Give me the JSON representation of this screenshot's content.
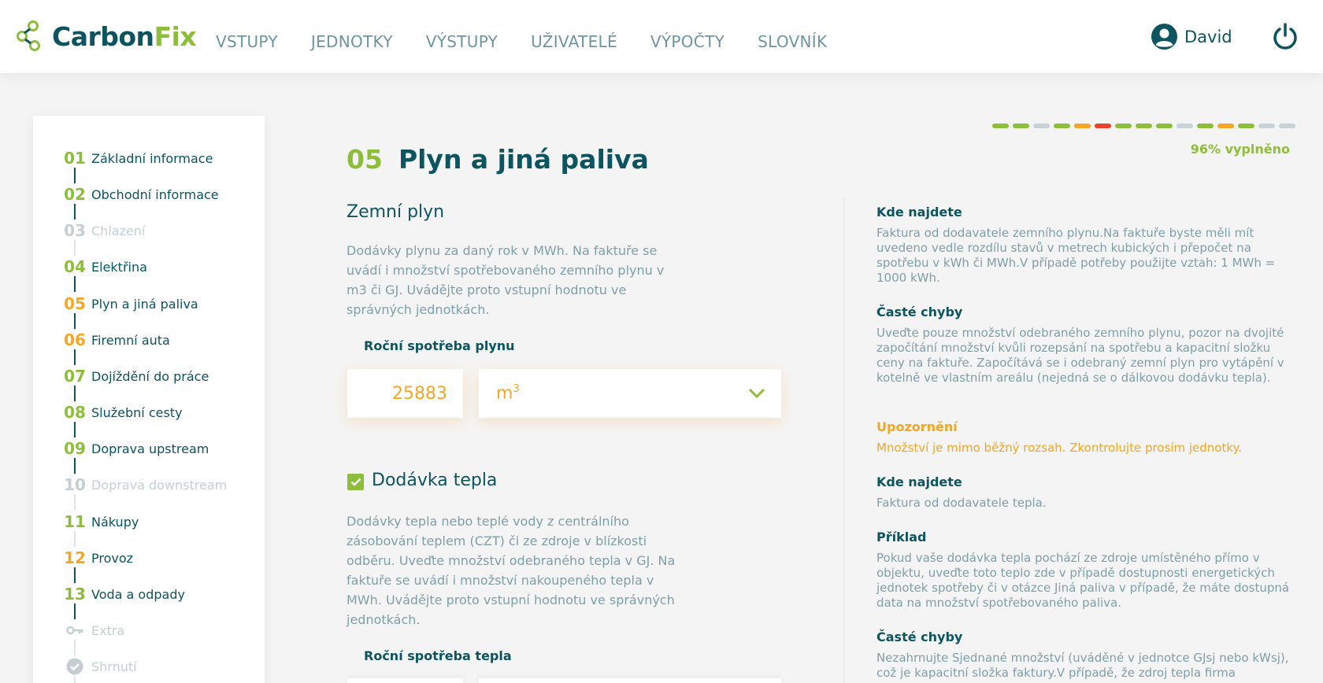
{
  "app": {
    "logo_part1": "Carbon",
    "logo_part2": "Fix",
    "brand_color": "#0c5460",
    "accent_color": "#8dbe3a",
    "warning_color": "#f5a623"
  },
  "nav": [
    "VSTUPY",
    "JEDNOTKY",
    "VÝSTUPY",
    "UŽIVATELÉ",
    "VÝPOČTY",
    "SLOVNÍK"
  ],
  "user": {
    "name": "David",
    "icon": "user-circle-icon",
    "logout_icon": "power-icon"
  },
  "sidebar": {
    "steps": [
      {
        "num": "01",
        "label": "Základní informace",
        "state": "done"
      },
      {
        "num": "02",
        "label": "Obchodní informace",
        "state": "done"
      },
      {
        "num": "03",
        "label": "Chlazení",
        "state": "disabled"
      },
      {
        "num": "04",
        "label": "Elektřina",
        "state": "done"
      },
      {
        "num": "05",
        "label": "Plyn a jiná paliva",
        "state": "active"
      },
      {
        "num": "06",
        "label": "Firemní auta",
        "state": "warning"
      },
      {
        "num": "07",
        "label": "Dojíždění do práce",
        "state": "done"
      },
      {
        "num": "08",
        "label": "Služební cesty",
        "state": "done"
      },
      {
        "num": "09",
        "label": "Doprava upstream",
        "state": "done"
      },
      {
        "num": "10",
        "label": "Doprava downstream",
        "state": "disabled"
      },
      {
        "num": "11",
        "label": "Nákupy",
        "state": "done"
      },
      {
        "num": "12",
        "label": "Provoz",
        "state": "warning"
      },
      {
        "num": "13",
        "label": "Voda a odpady",
        "state": "done"
      },
      {
        "num": "",
        "label": "Extra",
        "state": "disabled",
        "icon": "key-icon"
      },
      {
        "num": "",
        "label": "Shrnutí",
        "state": "disabled",
        "icon": "check-circle-icon"
      }
    ]
  },
  "main": {
    "section_num": "05",
    "section_title": "Plyn a jiná paliva",
    "gas": {
      "title": "Zemní plyn",
      "description": "Dodávky plynu za daný rok v MWh. Na faktuře se uvádí i množství spotřebovaného zemního plynu v m3 či GJ. Uvádějte proto vstupní hodnotu ve správných jednotkách.",
      "field_label": "Roční spotřeba plynu",
      "value": "25883",
      "unit": "m",
      "unit_sup": "3"
    },
    "heat": {
      "checkbox_label": "Dodávka tepla",
      "checked": true,
      "description": "Dodávky tepla nebo teplé vody z centrálního zásobování teplem (CZT) či ze zdroje v blízkosti odběru. Uveďte množství odebraného tepla v GJ. Na faktuře se uvádí i množství nakoupeného tepla v MWh. Uvádějte proto vstupní hodnotu ve správných jednotkách.",
      "field_label": "Roční spotřeba tepla"
    }
  },
  "help": {
    "kde1": {
      "title": "Kde najdete",
      "text": "Faktura od dodavatele zemního plynu.Na faktuře byste měli mít uvedeno vedle rozdílu stavů v metrech kubických i přepočet na spotřebu v kWh či MWh.V případě potřeby použijte vztah: 1 MWh = 1000 kWh."
    },
    "chyby1": {
      "title": "Časté chyby",
      "text": "Uveďte pouze množství odebraného zemního plynu, pozor na dvojité započítání množství kvůli rozepsání na spotřebu a kapacitní složku ceny na faktuře. Započítává se i odebraný zemní plyn pro vytápění v kotelně ve vlastním areálu (nejedná se o dálkovou dodávku tepla)."
    },
    "warning": {
      "title": "Upozornění",
      "text": "Množství je mimo běžný rozsah. Zkontrolujte prosím jednotky."
    },
    "kde2": {
      "title": "Kde najdete",
      "text": "Faktura od dodavatele tepla."
    },
    "priklad": {
      "title": "Příklad",
      "text": "Pokud vaše dodávka tepla pochází ze zdroje umístěného přímo v objektu, uveďte toto teplo zde v případě dostupnosti energetických jednotek spotřeby či v otázce Jiná paliva v případě, že máte dostupná data na množství spotřebovaného paliva."
    },
    "chyby2": {
      "title": "Časté chyby",
      "text": "Nezahrnujte Sjednané množství (uváděné v jednotce GJsj nebo kWsj), což je kapacitní složka faktury.V případě, že zdroj tepla firma"
    }
  },
  "progress": {
    "label": "96% vyplněno",
    "value_percent": 96,
    "segments": [
      "#8dbe3a",
      "#8dbe3a",
      "#c8d3d8",
      "#8dbe3a",
      "#f5a623",
      "#e8412c",
      "#8dbe3a",
      "#8dbe3a",
      "#8dbe3a",
      "#c8d3d8",
      "#8dbe3a",
      "#f5a623",
      "#8dbe3a",
      "#c8d3d8",
      "#c8d3d8"
    ]
  }
}
